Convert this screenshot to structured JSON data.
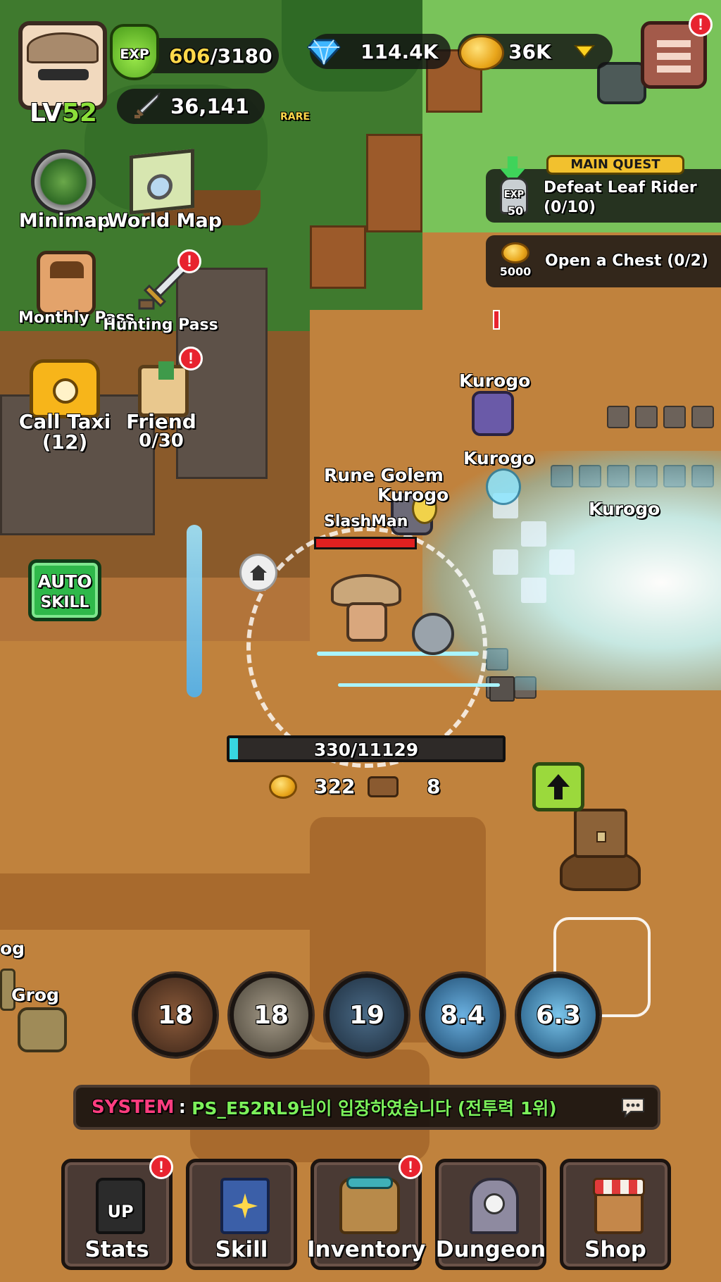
{
  "player": {
    "level_prefix": "LV",
    "level_value": "52",
    "exp_icon_label": "EXP",
    "exp_current": "606",
    "exp_max": "/3180",
    "combat_power": "36,141"
  },
  "currencies": {
    "gems": "114.4K",
    "gold": "36K"
  },
  "rare_badge": "RARE",
  "left_menu": {
    "minimap": "Minimap",
    "world_map": "World Map",
    "monthly_pass": "Monthly Pass",
    "hunting_pass": "Hunting Pass",
    "call_taxi": "Call Taxi",
    "call_taxi_count": "(12)",
    "friend": "Friend",
    "friend_count": "0/30"
  },
  "quests": {
    "main_quest_tag": "MAIN QUEST",
    "quest1_title": "Defeat Leaf Rider",
    "quest1_progress": "(0/10)",
    "quest1_reward_icon_label": "EXP",
    "quest1_reward": "50",
    "quest2_title": "Open a Chest (0/2)",
    "quest2_reward": "5000"
  },
  "enemies": {
    "kurogo_1": "Kurogo",
    "kurogo_2": "Kurogo",
    "kurogo_3": "Kurogo",
    "kurogo_4": "Kurogo",
    "rune_golem": "Rune Golem",
    "slashman": "SlashMan",
    "grog": "Grog",
    "grog_partial": "og"
  },
  "auto_skill": {
    "line1": "AUTO",
    "line2": "SKILL"
  },
  "stage": {
    "progress_text": "330/11129",
    "progress_fraction": 0.0297,
    "gold_earned": "322",
    "wood_earned": "8"
  },
  "skills": [
    {
      "cooldown": "18"
    },
    {
      "cooldown": "18"
    },
    {
      "cooldown": "19"
    },
    {
      "cooldown": "8.4"
    },
    {
      "cooldown": "6.3"
    }
  ],
  "chat": {
    "channel": "SYSTEM",
    "separator": ":",
    "message": "PS_E52RL9님이 입장하였습니다 (전투력 1위)"
  },
  "bottom_nav": {
    "stats": "Stats",
    "stats_icon_text": "UP",
    "skill": "Skill",
    "inventory": "Inventory",
    "dungeon": "Dungeon",
    "shop": "Shop"
  },
  "colors": {
    "level_green": "#8be03a",
    "exp_yellow": "#ffd84a",
    "quest_tag_bg": "#f2c12e",
    "system_pink": "#ff3d7f",
    "system_green": "#7cf05a",
    "alert_red": "#e8232f",
    "hp_red": "#e02020",
    "progress_cyan": "#38d6e0"
  }
}
